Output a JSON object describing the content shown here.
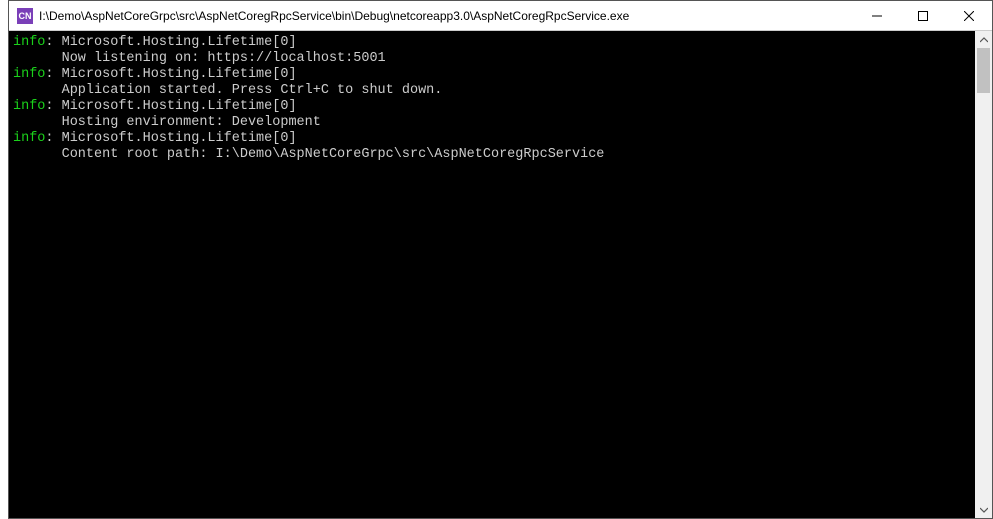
{
  "window": {
    "title": "I:\\Demo\\AspNetCoreGrpc\\src\\AspNetCoregRpcService\\bin\\Debug\\netcoreapp3.0\\AspNetCoregRpcService.exe",
    "icon_label": "CN"
  },
  "log_level_label": "info",
  "logs": [
    {
      "category": "Microsoft.Hosting.Lifetime[0]",
      "message": "Now listening on: https://localhost:5001"
    },
    {
      "category": "Microsoft.Hosting.Lifetime[0]",
      "message": "Application started. Press Ctrl+C to shut down."
    },
    {
      "category": "Microsoft.Hosting.Lifetime[0]",
      "message": "Hosting environment: Development"
    },
    {
      "category": "Microsoft.Hosting.Lifetime[0]",
      "message": "Content root path: I:\\Demo\\AspNetCoreGrpc\\src\\AspNetCoregRpcService"
    }
  ]
}
